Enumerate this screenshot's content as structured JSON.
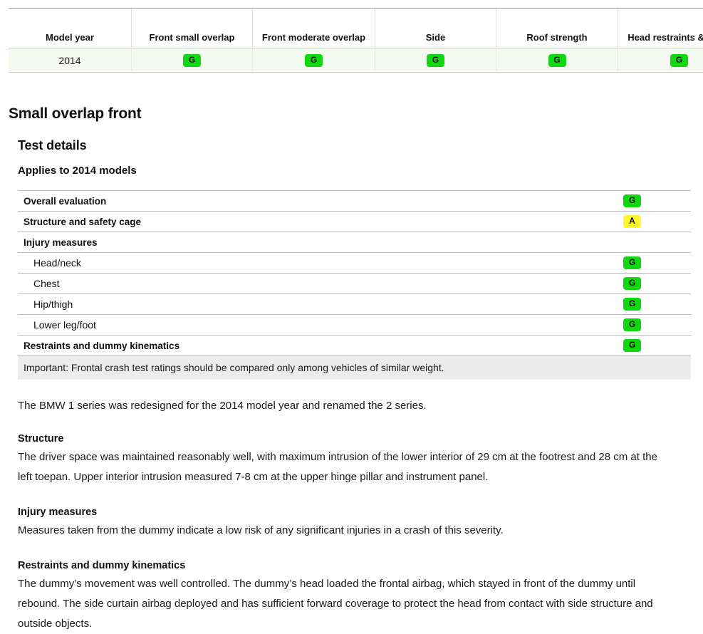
{
  "summary_table": {
    "headers": [
      "Model year",
      "Front small overlap",
      "Front moderate overlap",
      "Side",
      "Roof strength",
      "Head restraints & seats"
    ],
    "rows": [
      {
        "model_year": "2014",
        "front_small_overlap": "G",
        "front_moderate_overlap": "G",
        "side": "G",
        "roof_strength": "G",
        "head_restraints_seats": "G"
      }
    ]
  },
  "section": {
    "title": "Small overlap front",
    "subtitle": "Test details",
    "applies": "Applies to 2014 models"
  },
  "details_table": {
    "rows": [
      {
        "label": "Overall evaluation",
        "rating": "G",
        "style": "bold"
      },
      {
        "label": "Structure and safety cage",
        "rating": "A",
        "style": "bold"
      },
      {
        "label": "Injury measures",
        "rating": "",
        "style": "bold"
      },
      {
        "label": "Head/neck",
        "rating": "G",
        "style": "indent"
      },
      {
        "label": "Chest",
        "rating": "G",
        "style": "indent"
      },
      {
        "label": "Hip/thigh",
        "rating": "G",
        "style": "indent"
      },
      {
        "label": "Lower leg/foot",
        "rating": "G",
        "style": "indent"
      },
      {
        "label": "Restraints and dummy kinematics",
        "rating": "G",
        "style": "bold"
      }
    ]
  },
  "important_note": "Important: Frontal crash test ratings should be compared only among vehicles of similar weight.",
  "intro_paragraph": "The BMW 1 series was redesigned for the 2014 model year and renamed the 2 series.",
  "sections": [
    {
      "heading": "Structure",
      "text": "The driver space was maintained reasonably well, with maximum intrusion of the lower interior of 29 cm at the footrest and 28 cm at the left toepan. Upper interior intrusion measured 7-8 cm at the upper hinge pillar and instrument panel."
    },
    {
      "heading": "Injury measures",
      "text": "Measures taken from the dummy indicate a low risk of any significant injuries in a crash of this severity."
    },
    {
      "heading": "Restraints and dummy kinematics",
      "text": "The dummy’s movement was well controlled. The dummy’s head loaded the frontal airbag, which stayed in front of the dummy until rebound. The side curtain airbag deployed and has sufficient forward coverage to protect the head from contact with side structure and outside objects."
    }
  ],
  "rating_colors": {
    "good": "#10d810",
    "acceptable": "#fdf730",
    "marginal": "#ff9e18",
    "poor": "#ef3c3c"
  }
}
